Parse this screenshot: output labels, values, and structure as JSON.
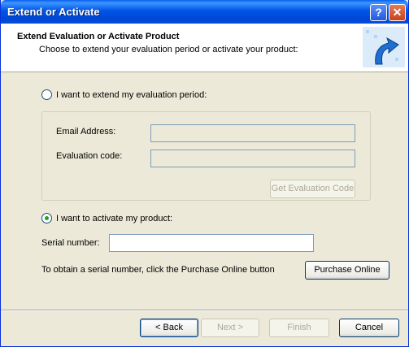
{
  "window": {
    "title": "Extend or Activate"
  },
  "titlebar": {
    "help_label": "?",
    "close_label": "✕"
  },
  "header": {
    "title": "Extend Evaluation or Activate Product",
    "subtitle": "Choose to extend your evaluation period or activate your product:"
  },
  "extend": {
    "radio_label": "I want to extend my evaluation period:",
    "selected": false,
    "email_label": "Email Address:",
    "email_value": "",
    "code_label": "Evaluation code:",
    "code_value": "",
    "get_code_label": "Get Evaluation Code"
  },
  "activate": {
    "radio_label": "I want to activate my product:",
    "selected": true,
    "serial_label": "Serial number:",
    "serial_value": "",
    "purchase_hint": "To obtain a serial number, click the Purchase Online button",
    "purchase_label": "Purchase Online"
  },
  "footer": {
    "back_label": "< Back",
    "next_label": "Next >",
    "finish_label": "Finish",
    "cancel_label": "Cancel"
  },
  "colors": {
    "titlebar": "#0055E5",
    "dialog_bg": "#ECE9D8",
    "radio_dot": "#21A121"
  }
}
